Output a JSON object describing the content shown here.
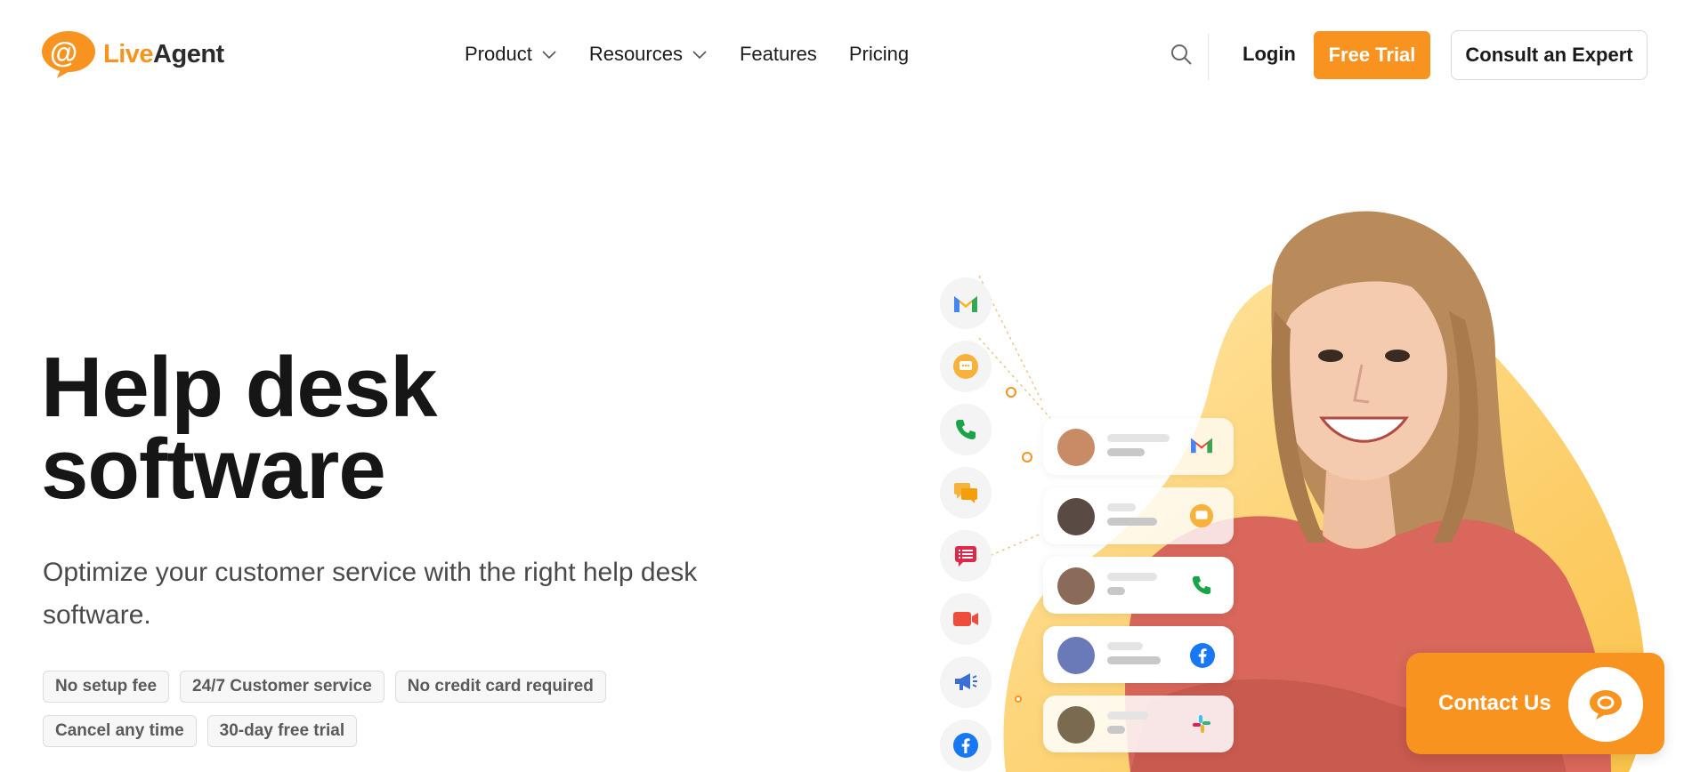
{
  "brand": {
    "name_part1": "Live",
    "name_part2": "Agent",
    "accent": "#f7931e"
  },
  "nav": {
    "items": [
      {
        "label": "Product",
        "dropdown": true
      },
      {
        "label": "Resources",
        "dropdown": true
      },
      {
        "label": "Features",
        "dropdown": false
      },
      {
        "label": "Pricing",
        "dropdown": false
      }
    ],
    "search_icon": "search-icon",
    "login_label": "Login",
    "trial_label": "Free Trial",
    "consult_label": "Consult an Expert"
  },
  "hero": {
    "title_line1": "Help desk",
    "title_line2": "software",
    "subtitle": "Optimize your customer service with the right help desk software.",
    "badges_row1": [
      "No setup fee",
      "24/7 Customer service",
      "No credit card required"
    ],
    "badges_row2": [
      "Cancel any time",
      "30-day free trial"
    ]
  },
  "channels": {
    "icons": [
      "gmail-icon",
      "chat-icon",
      "phone-icon",
      "messenger-icon",
      "form-icon",
      "video-icon",
      "megaphone-icon",
      "facebook-icon"
    ],
    "colors": {
      "gmail_red": "#ea4335",
      "chat_orange": "#f7931e",
      "phone_green": "#1aa44a",
      "facebook_blue": "#1877f2"
    }
  },
  "contact_widget": {
    "label": "Contact Us"
  }
}
